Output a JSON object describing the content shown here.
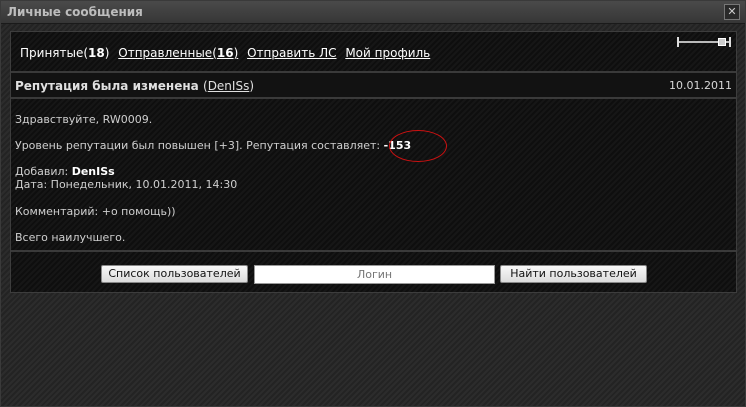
{
  "window": {
    "title": "Личные сообщения",
    "close_icon": "close-icon"
  },
  "tabs": {
    "inbox_label": "Принятые(",
    "inbox_count": "18",
    "inbox_close": ")",
    "sent_label": "Отправленные(",
    "sent_count": "16",
    "sent_close": ")",
    "send_label": "Отправить ЛС",
    "profile_label": "Мой профиль"
  },
  "message": {
    "subject": "Репутация была изменена",
    "author_open": "(",
    "author": "DenISs",
    "author_close": ")",
    "date": "10.01.2011",
    "greeting": "Здравствуйте, RW0009.",
    "rep_line": "Уровень репутации был повышен [+3]. Репутация составляет: ",
    "rep_value": "-153",
    "added_label": "Добавил: ",
    "added_by": "DenISs",
    "date_line": "Дата: Понедельник, 10.01.2011, 14:30",
    "comment": "Комментарий: +o помощь))",
    "closing": "Всего наилучшего."
  },
  "footer": {
    "users_list_button": "Список пользователей",
    "login_placeholder": "Логин",
    "find_users_button": "Найти пользователей"
  },
  "colors": {
    "highlight_circle": "#cc1111"
  }
}
